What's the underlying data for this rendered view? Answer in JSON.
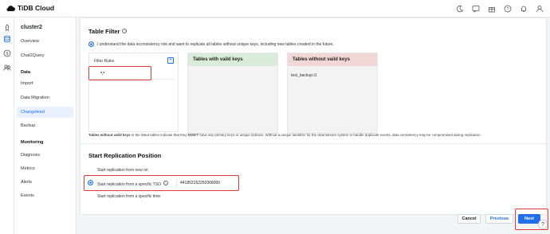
{
  "app": {
    "name": "TiDB Cloud"
  },
  "topbar": {
    "icons": [
      "moon-icon",
      "chat-icon",
      "gift-icon",
      "help-icon",
      "bell-icon",
      "user-icon"
    ]
  },
  "rail": {
    "icons": [
      "rocket-icon",
      "database-icon",
      "dollar-icon",
      "users-icon"
    ]
  },
  "sidebar": {
    "cluster": "cluster2",
    "items_top": [
      "Overview",
      "Chat2Query"
    ],
    "data_heading": "Data",
    "data_items": [
      "Import",
      "Data Migration",
      "Changefeed",
      "Backup"
    ],
    "active": "Changefeed",
    "monitoring_heading": "Monitoring",
    "monitoring_items": [
      "Diagnosis",
      "Metrics",
      "Alerts",
      "Events"
    ]
  },
  "table_filter": {
    "title": "Table Filter",
    "consent_text": "I understand the data inconsistency risk and want to replicate all tables without unique keys, including new tables created in the future.",
    "rules_label": "Filter Rules",
    "add_symbol": "+",
    "rule_value": "*.*",
    "valid_title": "Tables with vaild keys",
    "invalid_title": "Tables without vaild keys",
    "invalid_items": [
      "test_backup.t1"
    ],
    "note_bold": "Tables without valid keys",
    "note_mid": " in the listed tables indicate that they ",
    "note_dont": "DON'T",
    "note_rest": " have any primary keys or unique indexes. Without a unique identifier for the downstream system to handle duplicate events, data consistency may be compromised during replication"
  },
  "start_position": {
    "title": "Start Replication Position",
    "option_now": "Start replication from now on",
    "option_tso": "Start replication from a specific TSO",
    "tso_value": "441852152250368000",
    "option_time": "Start replication from a specific time",
    "selected": "tso"
  },
  "footer": {
    "cancel": "Cancel",
    "previous": "Previous",
    "next": "Next",
    "help": "?"
  },
  "colors": {
    "accent": "#1f6feb",
    "highlight": "#e53935",
    "valid_header": "#d9ecd9",
    "invalid_header": "#f2d7d7"
  }
}
